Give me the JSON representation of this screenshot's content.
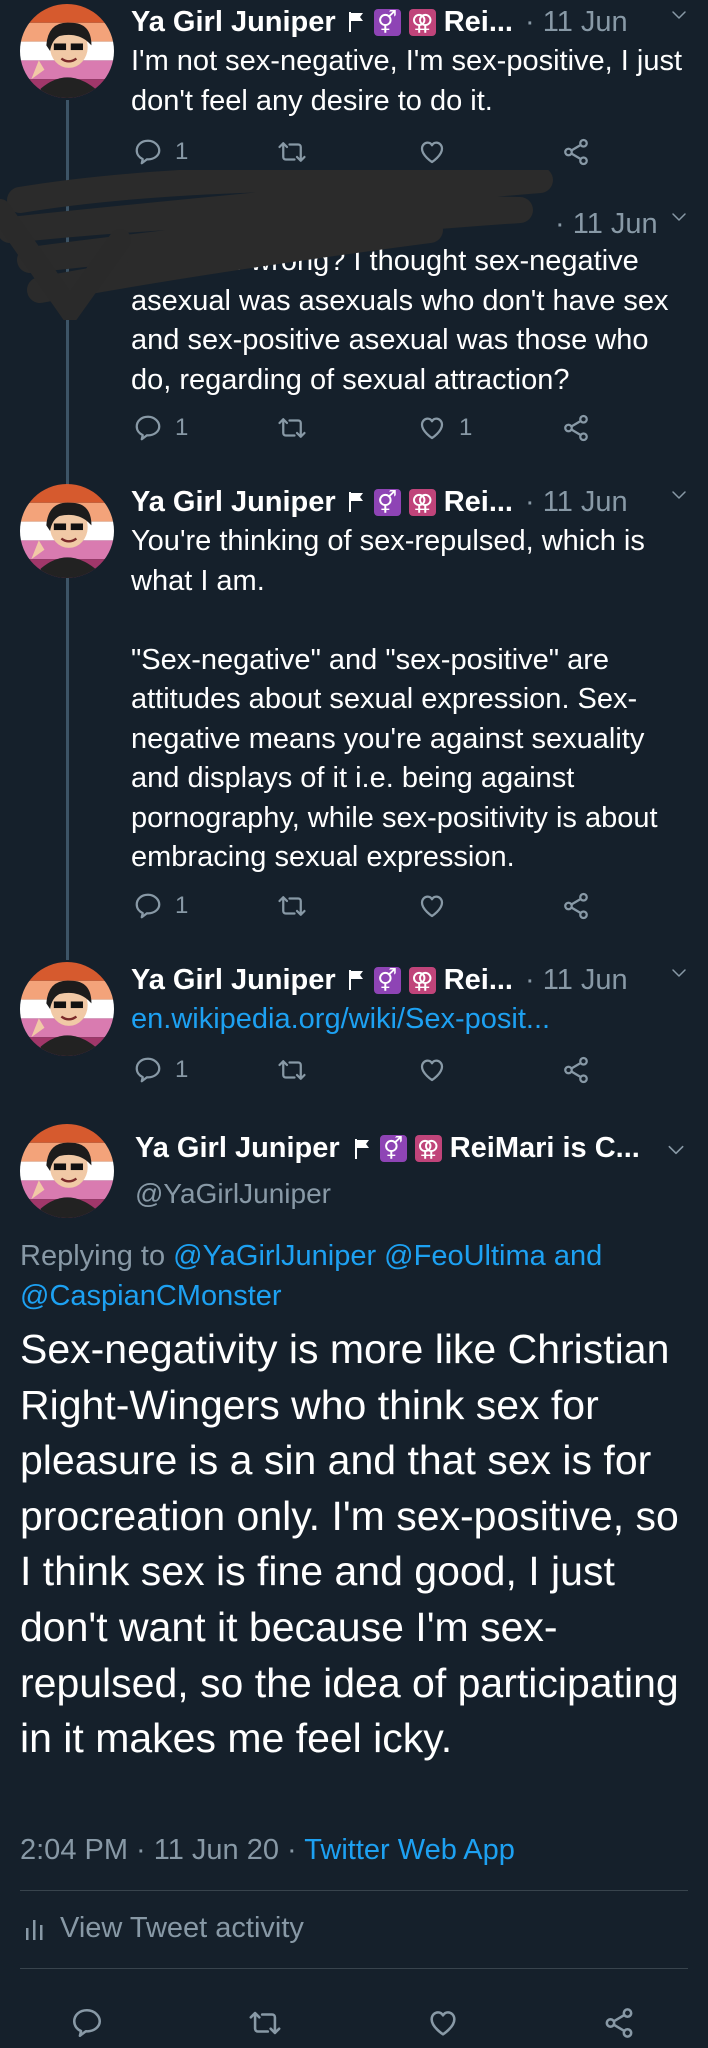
{
  "tweets": [
    {
      "name": "Ya Girl Juniper",
      "name_trunc": "Rei...",
      "date": "· 11 Jun",
      "text": "I'm not sex-negative, I'm sex-positive, I just don't feel any desire to do it.",
      "reply_count": "1",
      "retweet_count": "",
      "like_count": ""
    },
    {
      "name": "",
      "name_trunc": "",
      "date": "· 11 Jun",
      "text": "Oh, am I wrong? I thought sex-negative asexual was asexuals who don't have sex and sex-positive asexual was those who do, regarding of sexual attraction?",
      "reply_count": "1",
      "retweet_count": "",
      "like_count": "1"
    },
    {
      "name": "Ya Girl Juniper",
      "name_trunc": "Rei...",
      "date": "· 11 Jun",
      "text": "You're thinking of sex-repulsed, which is what I am.\n\n\"Sex-negative\" and \"sex-positive\" are attitudes about sexual expression. Sex-negative means you're against sexuality and displays of it i.e. being against pornography, while sex-positivity is about embracing sexual expression.",
      "reply_count": "1",
      "retweet_count": "",
      "like_count": ""
    },
    {
      "name": "Ya Girl Juniper",
      "name_trunc": "Rei...",
      "date": "· 11 Jun",
      "link": "en.wikipedia.org/wiki/Sex-posit...",
      "reply_count": "1",
      "retweet_count": "",
      "like_count": ""
    }
  ],
  "main": {
    "name": "Ya Girl Juniper",
    "name_trunc": "ReiMari is C...",
    "handle": "@YaGirlJuniper",
    "replying_prefix": "Replying to",
    "replying_users": "@YaGirlJuniper @FeoUltima",
    "replying_and": "and",
    "replying_last": "@CaspianCMonster",
    "text": "Sex-negativity is more like Christian Right-Wingers who think sex for pleasure is a sin and that sex is for procreation only. I'm sex-positive, so I think sex is fine and good, I just don't want it because I'm sex-repulsed, so the idea of participating in it makes me feel icky.",
    "time": "2:04 PM · 11 Jun 20 ·",
    "source": "Twitter Web App",
    "activity": "View Tweet activity"
  },
  "colors": {
    "background": "#15202b",
    "link": "#1da1f2",
    "muted": "#8899a6"
  },
  "icons": [
    "reply-icon",
    "retweet-icon",
    "like-icon",
    "share-icon",
    "chevron-down-icon",
    "flag-icon",
    "intersex-symbol-icon",
    "lesbian-symbol-icon",
    "bar-chart-icon"
  ]
}
